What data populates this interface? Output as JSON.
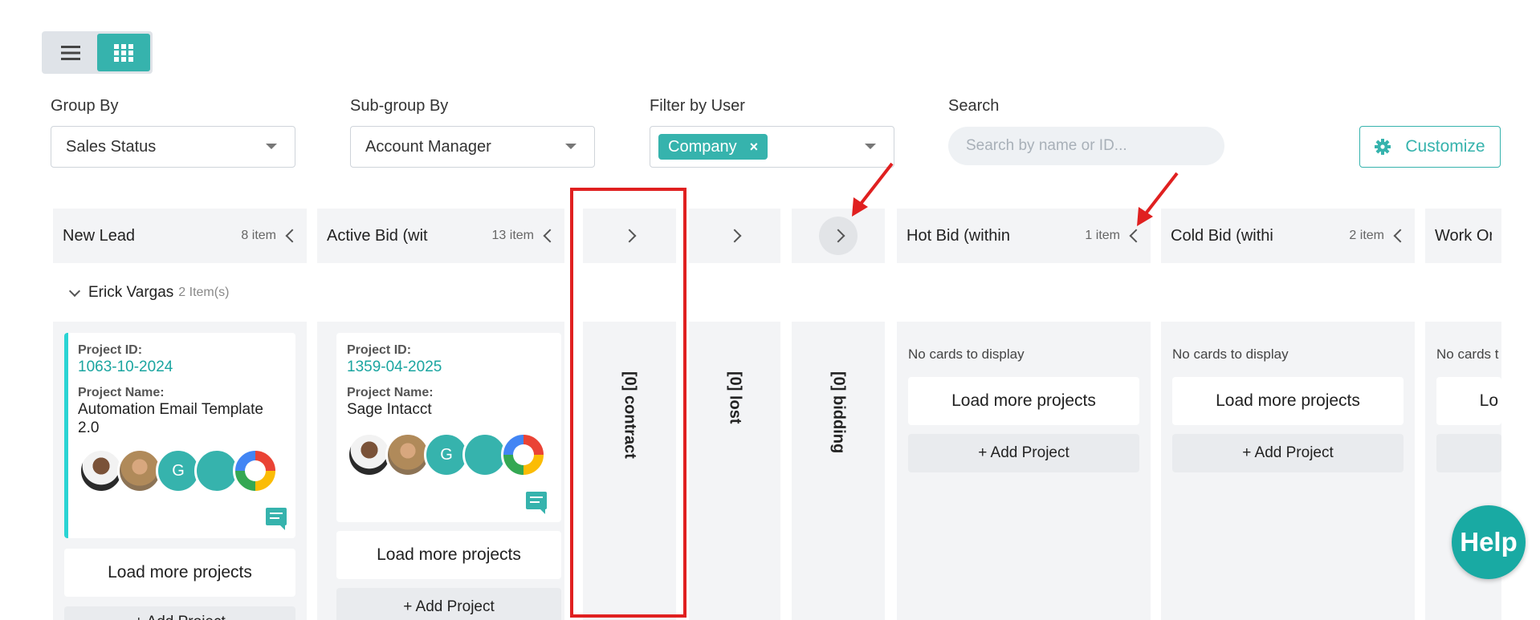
{
  "view_toggle": {
    "list_icon": "list-icon",
    "grid_icon": "grid-icon",
    "active": "grid"
  },
  "filters": {
    "group_by": {
      "label": "Group By",
      "value": "Sales Status"
    },
    "subgroup_by": {
      "label": "Sub-group By",
      "value": "Account Manager"
    },
    "filter_user": {
      "label": "Filter by User",
      "chip": "Company",
      "chip_remove": "×"
    },
    "search": {
      "label": "Search",
      "placeholder": "Search by name or ID..."
    },
    "customize_label": "Customize"
  },
  "columns": [
    {
      "title": "New Lead",
      "count": "8 item"
    },
    {
      "title": "Active Bid (wit",
      "count": "13 item"
    },
    {
      "title": "[0] contract",
      "collapsed": true
    },
    {
      "title": "[0] lost",
      "collapsed": true
    },
    {
      "title": "[0] bidding",
      "collapsed": true
    },
    {
      "title": "Hot Bid (within",
      "count": "1 item"
    },
    {
      "title": "Cold Bid (withi",
      "count": "2 item"
    },
    {
      "title": "Work Orc"
    }
  ],
  "subgroup": {
    "name": "Erick Vargas",
    "count": "2 Item(s)"
  },
  "cards": [
    {
      "id_label": "Project ID:",
      "id": "1063-10-2024",
      "name_label": "Project Name:",
      "name": "Automation Email Template 2.0",
      "avatar_letter": "G"
    },
    {
      "id_label": "Project ID:",
      "id": "1359-04-2025",
      "name_label": "Project Name:",
      "name": "Sage Intacct",
      "avatar_letter": "G"
    }
  ],
  "actions": {
    "load_more": "Load more projects",
    "add_project": "+ Add Project",
    "no_cards": "No cards to display",
    "no_cards_clipped": "No cards t",
    "load_more_clipped": "Lo"
  },
  "help_label": "Help",
  "colors": {
    "accent": "#36b3ad",
    "highlight": "#e02020"
  }
}
